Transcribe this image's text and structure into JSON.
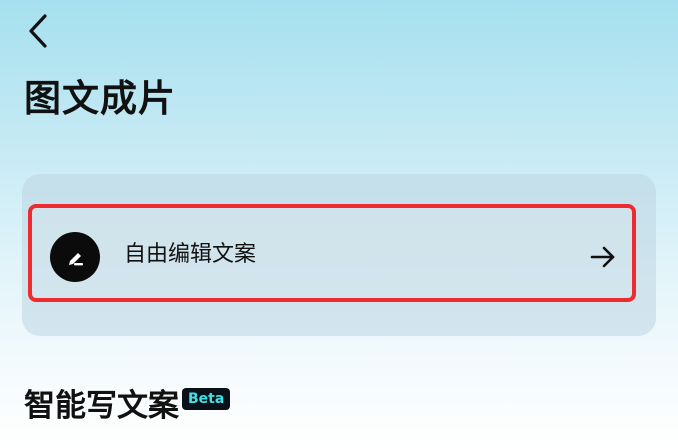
{
  "header": {
    "back_icon": "chevron-left-icon",
    "title": "图文成片"
  },
  "edit_option": {
    "icon": "pen-icon",
    "label": "自由编辑文案",
    "arrow_icon": "arrow-right-icon",
    "highlight_color": "#ee2b2e"
  },
  "ai_section": {
    "title": "智能写文案",
    "badge": "Beta",
    "badge_text_color": "#3ee1e6"
  }
}
